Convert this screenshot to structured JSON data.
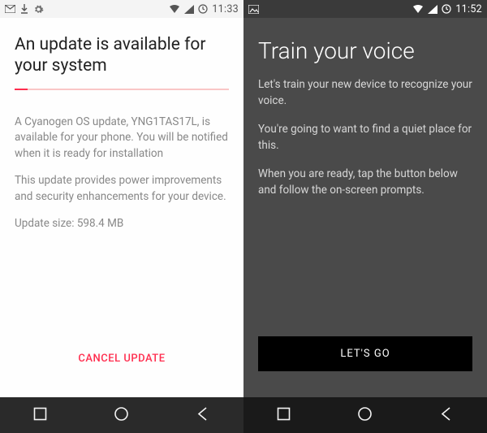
{
  "left": {
    "statusbar": {
      "time": "11:33"
    },
    "title": "An update is available for your system",
    "para1": "A Cyanogen OS update, YNG1TAS17L, is available for your phone. You will be notified when it is ready for installation",
    "para2": "This update provides power improvements and security enhancements for your device.",
    "size_line": "Update size: 598.4 MB",
    "cancel_label": "CANCEL UPDATE"
  },
  "right": {
    "statusbar": {
      "time": "11:52"
    },
    "title": "Train your voice",
    "para1": "Let's train your new device to recognize your voice.",
    "para2": "You're going to want to find a quiet place for this.",
    "para3": "When you are ready, tap the button below and follow the on-screen prompts.",
    "go_label": "LET'S GO"
  }
}
